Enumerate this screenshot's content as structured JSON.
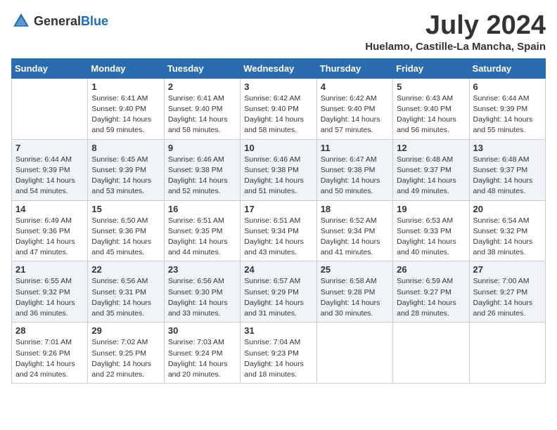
{
  "header": {
    "logo_general": "General",
    "logo_blue": "Blue",
    "title": "July 2024",
    "subtitle": "Huelamo, Castille-La Mancha, Spain"
  },
  "calendar": {
    "days_of_week": [
      "Sunday",
      "Monday",
      "Tuesday",
      "Wednesday",
      "Thursday",
      "Friday",
      "Saturday"
    ],
    "weeks": [
      [
        {
          "day": "",
          "info": ""
        },
        {
          "day": "1",
          "info": "Sunrise: 6:41 AM\nSunset: 9:40 PM\nDaylight: 14 hours\nand 59 minutes."
        },
        {
          "day": "2",
          "info": "Sunrise: 6:41 AM\nSunset: 9:40 PM\nDaylight: 14 hours\nand 58 minutes."
        },
        {
          "day": "3",
          "info": "Sunrise: 6:42 AM\nSunset: 9:40 PM\nDaylight: 14 hours\nand 58 minutes."
        },
        {
          "day": "4",
          "info": "Sunrise: 6:42 AM\nSunset: 9:40 PM\nDaylight: 14 hours\nand 57 minutes."
        },
        {
          "day": "5",
          "info": "Sunrise: 6:43 AM\nSunset: 9:40 PM\nDaylight: 14 hours\nand 56 minutes."
        },
        {
          "day": "6",
          "info": "Sunrise: 6:44 AM\nSunset: 9:39 PM\nDaylight: 14 hours\nand 55 minutes."
        }
      ],
      [
        {
          "day": "7",
          "info": "Sunrise: 6:44 AM\nSunset: 9:39 PM\nDaylight: 14 hours\nand 54 minutes."
        },
        {
          "day": "8",
          "info": "Sunrise: 6:45 AM\nSunset: 9:39 PM\nDaylight: 14 hours\nand 53 minutes."
        },
        {
          "day": "9",
          "info": "Sunrise: 6:46 AM\nSunset: 9:38 PM\nDaylight: 14 hours\nand 52 minutes."
        },
        {
          "day": "10",
          "info": "Sunrise: 6:46 AM\nSunset: 9:38 PM\nDaylight: 14 hours\nand 51 minutes."
        },
        {
          "day": "11",
          "info": "Sunrise: 6:47 AM\nSunset: 9:38 PM\nDaylight: 14 hours\nand 50 minutes."
        },
        {
          "day": "12",
          "info": "Sunrise: 6:48 AM\nSunset: 9:37 PM\nDaylight: 14 hours\nand 49 minutes."
        },
        {
          "day": "13",
          "info": "Sunrise: 6:48 AM\nSunset: 9:37 PM\nDaylight: 14 hours\nand 48 minutes."
        }
      ],
      [
        {
          "day": "14",
          "info": "Sunrise: 6:49 AM\nSunset: 9:36 PM\nDaylight: 14 hours\nand 47 minutes."
        },
        {
          "day": "15",
          "info": "Sunrise: 6:50 AM\nSunset: 9:36 PM\nDaylight: 14 hours\nand 45 minutes."
        },
        {
          "day": "16",
          "info": "Sunrise: 6:51 AM\nSunset: 9:35 PM\nDaylight: 14 hours\nand 44 minutes."
        },
        {
          "day": "17",
          "info": "Sunrise: 6:51 AM\nSunset: 9:34 PM\nDaylight: 14 hours\nand 43 minutes."
        },
        {
          "day": "18",
          "info": "Sunrise: 6:52 AM\nSunset: 9:34 PM\nDaylight: 14 hours\nand 41 minutes."
        },
        {
          "day": "19",
          "info": "Sunrise: 6:53 AM\nSunset: 9:33 PM\nDaylight: 14 hours\nand 40 minutes."
        },
        {
          "day": "20",
          "info": "Sunrise: 6:54 AM\nSunset: 9:32 PM\nDaylight: 14 hours\nand 38 minutes."
        }
      ],
      [
        {
          "day": "21",
          "info": "Sunrise: 6:55 AM\nSunset: 9:32 PM\nDaylight: 14 hours\nand 36 minutes."
        },
        {
          "day": "22",
          "info": "Sunrise: 6:56 AM\nSunset: 9:31 PM\nDaylight: 14 hours\nand 35 minutes."
        },
        {
          "day": "23",
          "info": "Sunrise: 6:56 AM\nSunset: 9:30 PM\nDaylight: 14 hours\nand 33 minutes."
        },
        {
          "day": "24",
          "info": "Sunrise: 6:57 AM\nSunset: 9:29 PM\nDaylight: 14 hours\nand 31 minutes."
        },
        {
          "day": "25",
          "info": "Sunrise: 6:58 AM\nSunset: 9:28 PM\nDaylight: 14 hours\nand 30 minutes."
        },
        {
          "day": "26",
          "info": "Sunrise: 6:59 AM\nSunset: 9:27 PM\nDaylight: 14 hours\nand 28 minutes."
        },
        {
          "day": "27",
          "info": "Sunrise: 7:00 AM\nSunset: 9:27 PM\nDaylight: 14 hours\nand 26 minutes."
        }
      ],
      [
        {
          "day": "28",
          "info": "Sunrise: 7:01 AM\nSunset: 9:26 PM\nDaylight: 14 hours\nand 24 minutes."
        },
        {
          "day": "29",
          "info": "Sunrise: 7:02 AM\nSunset: 9:25 PM\nDaylight: 14 hours\nand 22 minutes."
        },
        {
          "day": "30",
          "info": "Sunrise: 7:03 AM\nSunset: 9:24 PM\nDaylight: 14 hours\nand 20 minutes."
        },
        {
          "day": "31",
          "info": "Sunrise: 7:04 AM\nSunset: 9:23 PM\nDaylight: 14 hours\nand 18 minutes."
        },
        {
          "day": "",
          "info": ""
        },
        {
          "day": "",
          "info": ""
        },
        {
          "day": "",
          "info": ""
        }
      ]
    ]
  }
}
